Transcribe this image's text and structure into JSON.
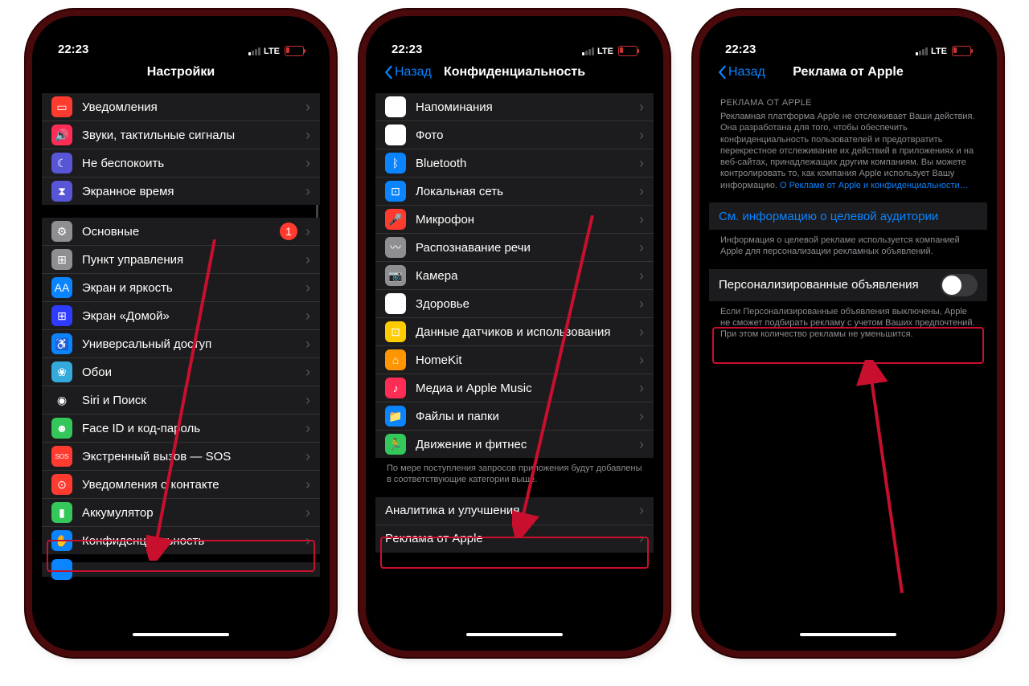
{
  "status": {
    "time": "22:23",
    "net": "LTE"
  },
  "screen1": {
    "title": "Настройки",
    "groupA": [
      {
        "label": "Уведомления",
        "color": "#ff3b30",
        "glyph": "▭"
      },
      {
        "label": "Звуки, тактильные сигналы",
        "color": "#ff2d55",
        "glyph": "🔊"
      },
      {
        "label": "Не беспокоить",
        "color": "#5856d6",
        "glyph": "☾"
      },
      {
        "label": "Экранное время",
        "color": "#5856d6",
        "glyph": "⧗"
      }
    ],
    "groupB": [
      {
        "label": "Основные",
        "color": "#8e8e93",
        "glyph": "⚙",
        "badge": "1"
      },
      {
        "label": "Пункт управления",
        "color": "#8e8e93",
        "glyph": "⊞"
      },
      {
        "label": "Экран и яркость",
        "color": "#0a84ff",
        "glyph": "AA"
      },
      {
        "label": "Экран «Домой»",
        "color": "#2f3cff",
        "glyph": "⊞"
      },
      {
        "label": "Универсальный доступ",
        "color": "#0a84ff",
        "glyph": "♿"
      },
      {
        "label": "Обои",
        "color": "#34aadc",
        "glyph": "❀"
      },
      {
        "label": "Siri и Поиск",
        "color": "#1c1c1e",
        "glyph": "◉"
      },
      {
        "label": "Face ID и код-пароль",
        "color": "#34c759",
        "glyph": "☻"
      },
      {
        "label": "Экстренный вызов — SOS",
        "color": "#ff3b30",
        "glyph": "SOS"
      },
      {
        "label": "Уведомления о контакте",
        "color": "#ff3b30",
        "glyph": "⊙"
      },
      {
        "label": "Аккумулятор",
        "color": "#34c759",
        "glyph": "▮"
      },
      {
        "label": "Конфиденциальность",
        "color": "#0a84ff",
        "glyph": "✋"
      }
    ]
  },
  "screen2": {
    "back": "Назад",
    "title": "Конфиденциальность",
    "groupA": [
      {
        "label": "Напоминания",
        "color": "#ffffff",
        "glyph": "☰"
      },
      {
        "label": "Фото",
        "color": "#ffffff",
        "glyph": "❁"
      },
      {
        "label": "Bluetooth",
        "color": "#0a84ff",
        "glyph": "ᛒ"
      },
      {
        "label": "Локальная сеть",
        "color": "#0a84ff",
        "glyph": "⊡"
      },
      {
        "label": "Микрофон",
        "color": "#ff3b30",
        "glyph": "🎤"
      },
      {
        "label": "Распознавание речи",
        "color": "#8e8e93",
        "glyph": "〰"
      },
      {
        "label": "Камера",
        "color": "#8e8e93",
        "glyph": "📷"
      },
      {
        "label": "Здоровье",
        "color": "#ffffff",
        "glyph": "♥"
      },
      {
        "label": "Данные датчиков и использования",
        "color": "#ffcc00",
        "glyph": "⊡"
      },
      {
        "label": "HomeKit",
        "color": "#ff9500",
        "glyph": "⌂"
      },
      {
        "label": "Медиа и Apple Music",
        "color": "#ff2d55",
        "glyph": "♪"
      },
      {
        "label": "Файлы и папки",
        "color": "#0a84ff",
        "glyph": "📁"
      },
      {
        "label": "Движение и фитнес",
        "color": "#34c759",
        "glyph": "🏃"
      }
    ],
    "footerA": "По мере поступления запросов приложения будут добавлены в соответствующие категории выше.",
    "groupB": [
      {
        "label": "Аналитика и улучшения"
      },
      {
        "label": "Реклама от Apple"
      }
    ]
  },
  "screen3": {
    "back": "Назад",
    "title": "Реклама от Apple",
    "header": "РЕКЛАМА ОТ APPLE",
    "intro": "Рекламная платформа Apple не отслеживает Ваши действия. Она разработана для того, чтобы обеспечить конфиденциальность пользователей и предотвратить перекрестное отслеживание их действий в приложениях и на веб-сайтах, принадлежащих другим компаниям. Вы можете контролировать то, как компания Apple использует Вашу информацию. ",
    "introLink": "О Рекламе от Apple и конфиденциальности…",
    "row1": "См. информацию о целевой аудитории",
    "footer1": "Информация о целевой рекламе используется компанией Apple для персонализации рекламных объявлений.",
    "row2": "Персонализированные объявления",
    "footer2": "Если Персонализированные объявления выключены, Apple не сможет подбирать рекламу с учетом Ваших предпочтений. При этом количество рекламы не уменьшится."
  }
}
